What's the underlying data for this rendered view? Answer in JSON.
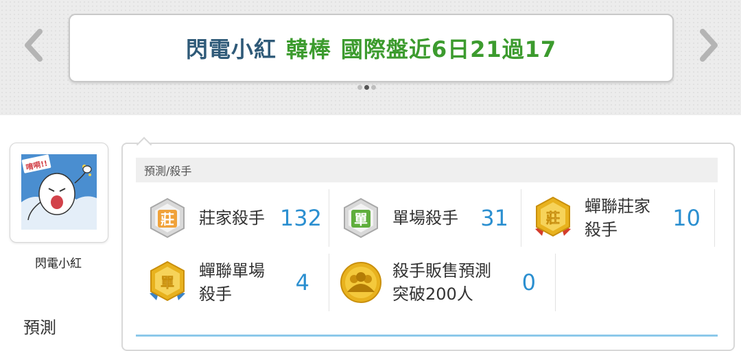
{
  "banner": {
    "name": "閃電小紅",
    "team": "韓棒",
    "record": "國際盤近6日21過17",
    "slides_total": 3,
    "slides_active": 2
  },
  "profile": {
    "name": "閃電小紅",
    "avatar_caption": "唷嗬!!",
    "side_heading": "預測"
  },
  "section": {
    "title": "預測/殺手"
  },
  "badges": [
    {
      "icon": "zhuang-silver-badge-icon",
      "glyph": "莊",
      "label": "莊家殺手",
      "count": "132"
    },
    {
      "icon": "dan-silver-badge-icon",
      "glyph": "單",
      "label": "單場殺手",
      "count": "31"
    },
    {
      "icon": "zhuang-gold-ribbon-badge-icon",
      "glyph": "莊",
      "label": "蟬聯莊家殺手",
      "label_line1": "蟬聯莊家",
      "label_line2": "殺手",
      "count": "10"
    },
    {
      "icon": "dan-gold-ribbon-badge-icon",
      "glyph": "單",
      "label": "蟬聯單場殺手",
      "label_line1": "蟬聯單場",
      "label_line2": "殺手",
      "count": "4"
    },
    {
      "icon": "users-gold-coin-icon",
      "label": "殺手販售預測突破200人",
      "label_line1": "殺手販售預測",
      "label_line2": "突破200人",
      "count": "0"
    }
  ],
  "colors": {
    "name": "#2f5a78",
    "green": "#3c9b2e",
    "count": "#2b8fd0",
    "gold": "#e8b21e",
    "silver": "#bdbdbd",
    "ribbon_blue": "#3b82c4",
    "ribbon_red": "#d43c2c"
  }
}
